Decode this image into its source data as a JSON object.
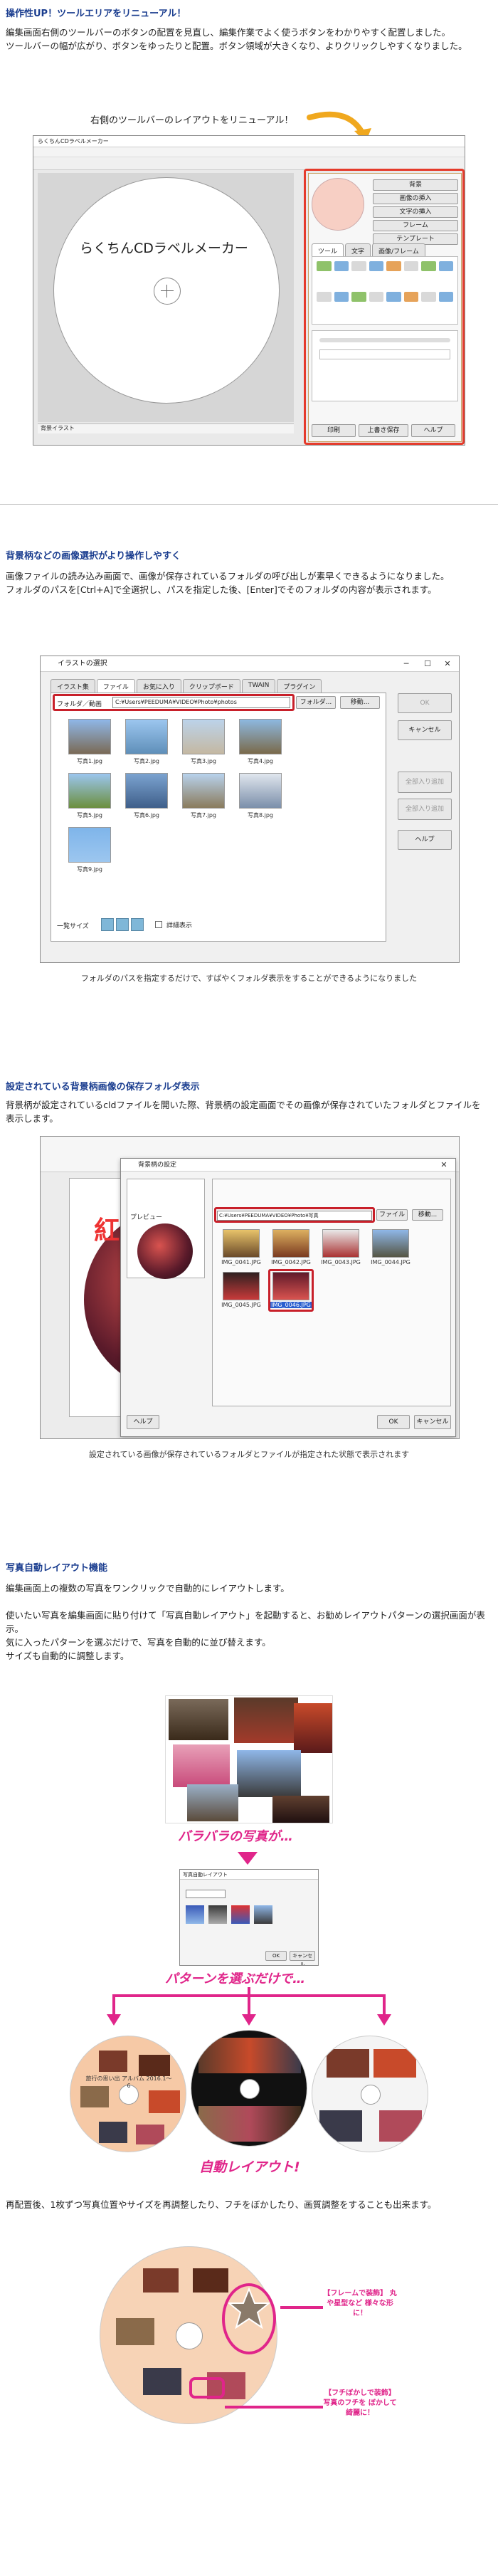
{
  "section1": {
    "title": "操作性UP！ツールエリアをリニューアル！",
    "lines": [
      "編集画面右側のツールバーのボタンの配置を見直し、編集作業でよく使うボタンをわかりやすく配置しました。",
      "ツールバーの幅が広がり、ボタンをゆったりと配置。ボタン領域が大きくなり、よりクリックしやすくなりました。"
    ],
    "callout": "右側のツールバーのレイアウトをリニューアル！",
    "app_title": "らくちんCDラベルメーカー",
    "disc_label": "らくちんCDラベルメーカー",
    "tool_tabs": [
      "ツール",
      "文字",
      "画像/フレーム"
    ],
    "tool_buttons": [
      "背景",
      "画像の挿入",
      "文字の挿入",
      "フレーム",
      "テンプレート"
    ],
    "bottom_buttons": [
      "印刷",
      "上書き保存",
      "ヘルプ"
    ],
    "status_tab": "背景イラスト"
  },
  "section2": {
    "title": "背景柄などの画像選択がより操作しやすく",
    "lines": [
      "画像ファイルの読み込み画面で、画像が保存されているフォルダの呼び出しが素早くできるようになりました。",
      "フォルダのパスを[Ctrl+A]で全選択し、パスを指定した後、[Enter]でそのフォルダの内容が表示されます。"
    ],
    "dialog_title": "イラストの選択",
    "tabs": [
      "イラスト集",
      "ファイル",
      "お気に入り",
      "クリップボード",
      "TWAIN",
      "プラグイン"
    ],
    "folder_label": "フォルダ／動画",
    "folder_path": "C:¥Users¥PEEDUMA¥VIDEO¥Photo¥photos",
    "folder_button": "フォルダ...",
    "move_button": "移動...",
    "side_buttons": [
      "OK",
      "キャンセル",
      "全部入り追加",
      "全部入り追加",
      "ヘルプ"
    ],
    "thumbs": [
      "写真1.jpg",
      "写真2.jpg",
      "写真3.jpg",
      "写真4.jpg",
      "写真5.jpg",
      "写真6.jpg",
      "写真7.jpg",
      "写真8.jpg",
      "写真9.jpg"
    ],
    "view_label": "一覧サイズ",
    "detail_checkbox": "詳細表示",
    "caption": "フォルダのパスを指定するだけで、すばやくフォルダ表示をすることができるようになりました"
  },
  "section3": {
    "title": "設定されている背景柄画像の保存フォルダ表示",
    "lines": [
      "背景柄が設定されているcldファイルを開いた際、背景柄の設定画面でその画像が保存されていたフォルダとファイルを表示します。"
    ],
    "dialog_title": "背景柄の設定",
    "preview_label": "プレビュー",
    "folder_path": "C:¥Users¥PEEDUMA¥VIDEO¥Photo¥写真",
    "file_buttons": [
      "ファイル",
      "移動..."
    ],
    "thumbs": [
      "IMG_0041.JPG",
      "IMG_0042.JPG",
      "IMG_0043.JPG",
      "IMG_0044.JPG",
      "IMG_0045.JPG",
      "IMG_0046.JPG"
    ],
    "bottom_buttons": [
      "OK",
      "キャンセル",
      "ヘルプ"
    ],
    "disc_text": "紅",
    "caption": "設定されている画像が保存されているフォルダとファイルが指定された状態で表示されます"
  },
  "section4": {
    "title": "写真自動レイアウト機能",
    "lines": [
      "編集画面上の複数の写真をワンクリックで自動的にレイアウトします。",
      "",
      "使いたい写真を編集画面に貼り付けて「写真自動レイアウト」を起動すると、お勧めレイアウトパターンの選択画面が表示。",
      "気に入ったパターンを選ぶだけで、写真を自動的に並び替えます。",
      "サイズも自動的に調整します。"
    ],
    "label_scattered": "バラバラの写真が…",
    "label_choose": "パターンを選ぶだけで…",
    "label_auto": "自動レイアウト!",
    "dialog_title": "写真自動レイアウト",
    "dialog_buttons": [
      "OK",
      "キャンセル"
    ],
    "disc_text": "旅行の思い出 アルバム 2016.1～6",
    "accent": "#e0258a"
  },
  "section5": {
    "lines": [
      "再配置後、1枚ずつ写真位置やサイズを再調整したり、フチをぼかしたり、画質調整をすることも出来ます。"
    ],
    "note_frame": "【フレームで装飾】 丸や星型など 様々な形に！",
    "note_blur": "【フチぼかしで装飾】 写真のフチを ぼかして綺麗に！"
  }
}
